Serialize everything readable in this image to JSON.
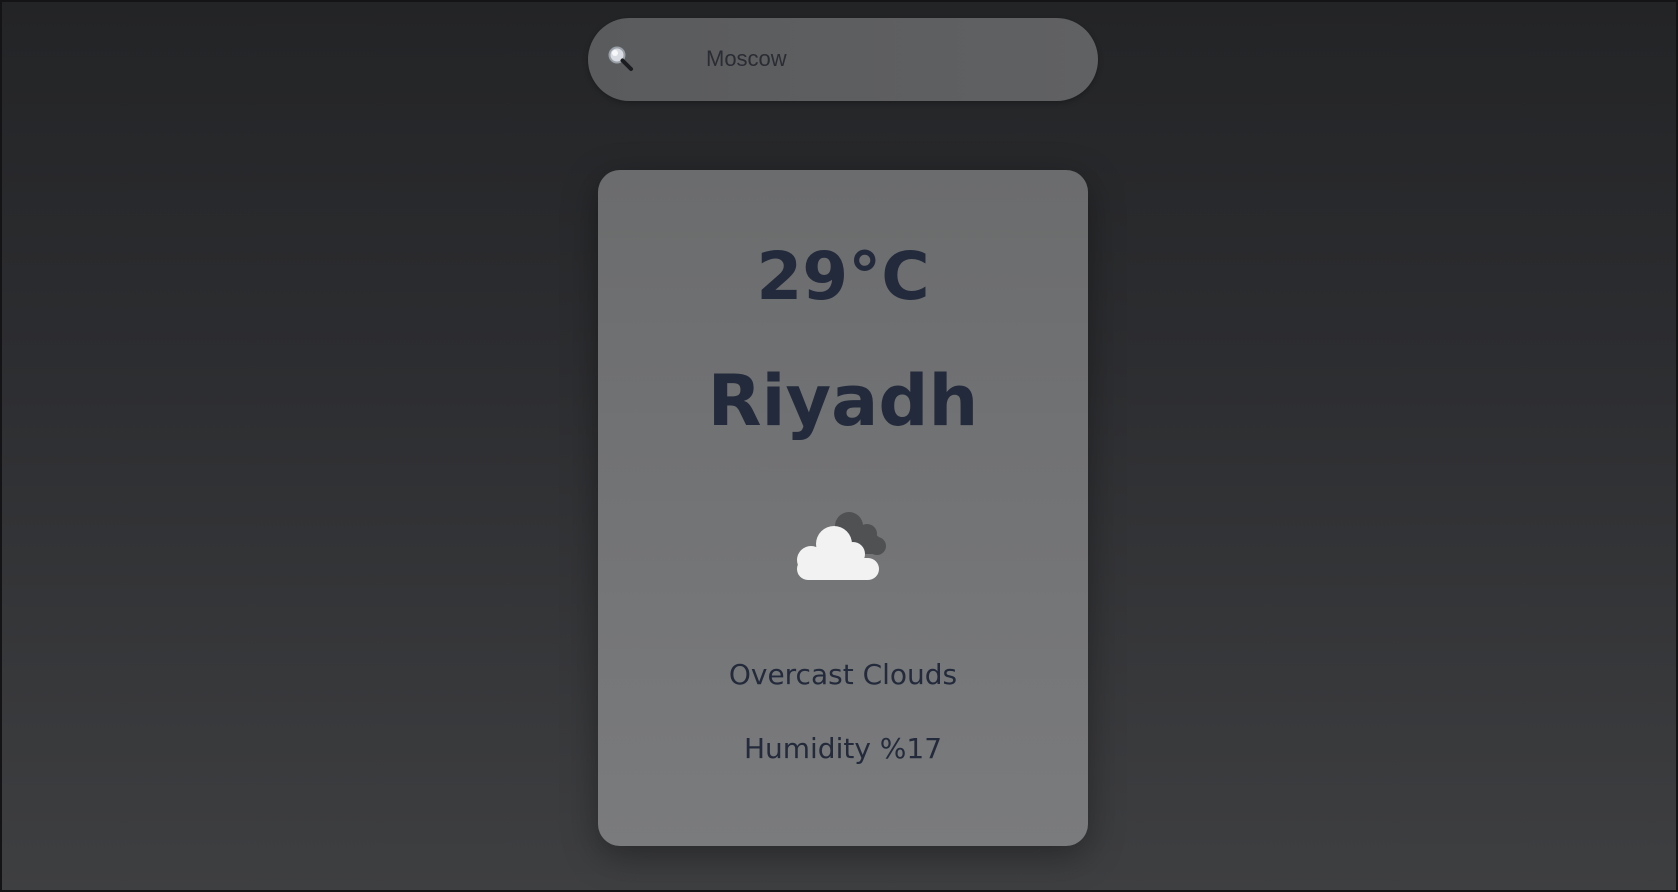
{
  "search": {
    "value": "Moscow",
    "icon": "search-icon"
  },
  "weather": {
    "temperature": "29°C",
    "city": "Riyadh",
    "icon": "overcast-clouds-icon",
    "description": "Overcast Clouds",
    "humidity": "Humidity %17"
  },
  "colors": {
    "text": "#232a3b",
    "card": "#707173",
    "search_bar": "#5d5e60",
    "background_top": "#232426",
    "background_bottom": "#3e3f41"
  }
}
